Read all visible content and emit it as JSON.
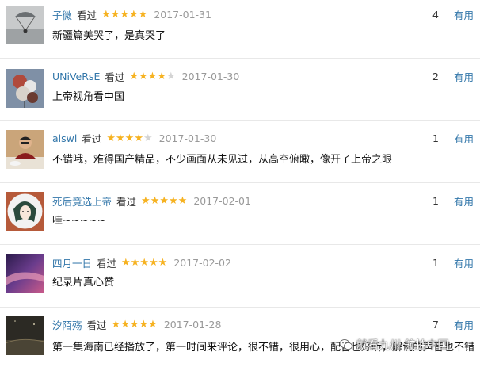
{
  "reviews": [
    {
      "username": "子微",
      "watched": "看过",
      "rating": 5,
      "date": "2017-01-31",
      "votes": "4",
      "useful": "有用",
      "comment": "新疆篇美哭了，是真哭了",
      "avatar_icon": "parachute-photo-icon"
    },
    {
      "username": "UNiVeRsE",
      "watched": "看过",
      "rating": 4,
      "date": "2017-01-30",
      "votes": "2",
      "useful": "有用",
      "comment": "上帝视角看中国",
      "avatar_icon": "balloons-photo-icon"
    },
    {
      "username": "alswl",
      "watched": "看过",
      "rating": 4,
      "date": "2017-01-30",
      "votes": "1",
      "useful": "有用",
      "comment": "不错哦，难得国产精品，不少画面从未见过，从高空俯瞰，像开了上帝之眼",
      "avatar_icon": "person-photo-icon"
    },
    {
      "username": "死后竟选上帝",
      "watched": "看过",
      "rating": 5,
      "date": "2017-02-01",
      "votes": "1",
      "useful": "有用",
      "comment": "哇~~~~~",
      "avatar_icon": "anime-portrait-icon"
    },
    {
      "username": "四月一日",
      "watched": "看过",
      "rating": 5,
      "date": "2017-02-02",
      "votes": "1",
      "useful": "有用",
      "comment": "纪录片真心赞",
      "avatar_icon": "purple-abstract-icon"
    },
    {
      "username": "汐陌殇",
      "watched": "看过",
      "rating": 5,
      "date": "2017-01-28",
      "votes": "7",
      "useful": "有用",
      "comment": "第一集海南已经播放了，第一时间来评论，很不错，很用心，配音也好听，解说的声音也不错",
      "avatar_icon": "dark-landscape-icon"
    }
  ],
  "watermark": {
    "text": "就看九州·航拍中国",
    "icon": "wechat-icon"
  }
}
